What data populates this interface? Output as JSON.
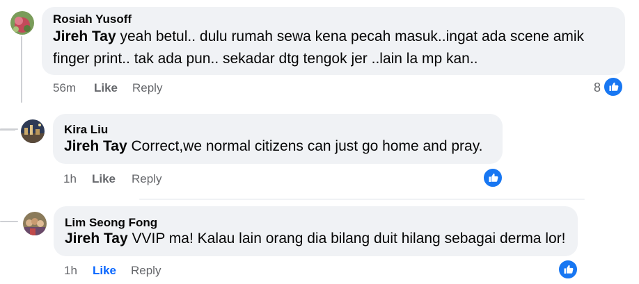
{
  "comments": [
    {
      "author": "Rosiah Yusoff",
      "mention": "Jireh Tay",
      "line1": " yeah betul.. dulu rumah sewa kena pecah masuk..ingat ada scene amik",
      "line2": "finger print.. tak ada pun.. sekadar dtg tengok jer ..lain la mp kan..",
      "time": "56m",
      "like_label": "Like",
      "reply_label": "Reply",
      "reaction_count": "8",
      "liked": false
    },
    {
      "author": "Kira Liu",
      "mention": "Jireh Tay",
      "line1": " Correct,we normal citizens can just go home and pray.",
      "time": "1h",
      "like_label": "Like",
      "reply_label": "Reply",
      "liked": false
    },
    {
      "author": "Lim Seong Fong",
      "mention": "Jireh Tay",
      "line1": " VVIP ma! Kalau lain orang dia bilang duit hilang sebagai derma lor!",
      "time": "1h",
      "like_label": "Like",
      "reply_label": "Reply",
      "liked": true
    }
  ],
  "icons": {
    "reaction": "like-reaction-icon"
  },
  "colors": {
    "bubble": "#f0f2f5",
    "meta": "#65676b",
    "accent": "#0866ff",
    "reaction_blue": "#1877f2"
  }
}
